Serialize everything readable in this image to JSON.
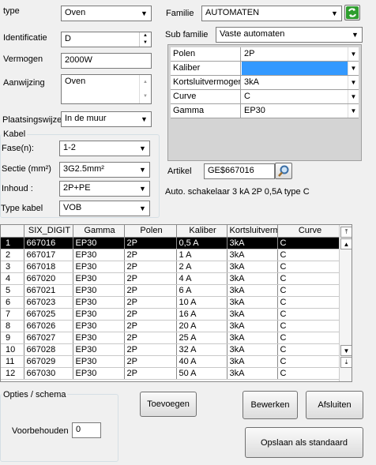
{
  "form": {
    "type_label": "type",
    "type_value": "Oven",
    "identificatie_label": "Identificatie",
    "identificatie_value": "D",
    "vermogen_label": "Vermogen",
    "vermogen_value": "2000W",
    "aanwijzing_label": "Aanwijzing",
    "aanwijzing_value": "Oven",
    "plaatsingswijze_label": "Plaatsingswijze",
    "plaatsingswijze_value": "In de muur"
  },
  "kabel": {
    "legend": "Kabel",
    "fase_label": "Fase(n):",
    "fase_value": "1-2",
    "sectie_label": "Sectie (mm²)",
    "sectie_value": "3G2.5mm²",
    "inhoud_label": "Inhoud :",
    "inhoud_value": "2P+PE",
    "type_kabel_label": "Type kabel",
    "type_kabel_value": "VOB"
  },
  "familie": {
    "label": "Familie",
    "value": "AUTOMATEN",
    "sub_label": "Sub familie",
    "sub_value": "Vaste automaten"
  },
  "properties": [
    {
      "name": "Polen",
      "value": "2P",
      "selected": false
    },
    {
      "name": "Kaliber",
      "value": "",
      "selected": true
    },
    {
      "name": "Kortsluitvermogen",
      "value": "3kA",
      "selected": false
    },
    {
      "name": "Curve",
      "value": "C",
      "selected": false
    },
    {
      "name": "Gamma",
      "value": "EP30",
      "selected": false
    }
  ],
  "artikel": {
    "label": "Artikel",
    "value": "GE$667016",
    "description": "Auto. schakelaar 3 kA 2P 0,5A type C"
  },
  "table": {
    "columns": [
      "SIX_DIGIT",
      "Gamma",
      "Polen",
      "Kaliber",
      "Kortsluitverm",
      "Curve"
    ],
    "rows": [
      [
        "1",
        "667016",
        "EP30",
        "2P",
        "0,5 A",
        "3kA",
        "C"
      ],
      [
        "2",
        "667017",
        "EP30",
        "2P",
        "1 A",
        "3kA",
        "C"
      ],
      [
        "3",
        "667018",
        "EP30",
        "2P",
        "2 A",
        "3kA",
        "C"
      ],
      [
        "4",
        "667020",
        "EP30",
        "2P",
        "4 A",
        "3kA",
        "C"
      ],
      [
        "5",
        "667021",
        "EP30",
        "2P",
        "6 A",
        "3kA",
        "C"
      ],
      [
        "6",
        "667023",
        "EP30",
        "2P",
        "10 A",
        "3kA",
        "C"
      ],
      [
        "7",
        "667025",
        "EP30",
        "2P",
        "16 A",
        "3kA",
        "C"
      ],
      [
        "8",
        "667026",
        "EP30",
        "2P",
        "20 A",
        "3kA",
        "C"
      ],
      [
        "9",
        "667027",
        "EP30",
        "2P",
        "25 A",
        "3kA",
        "C"
      ],
      [
        "10",
        "667028",
        "EP30",
        "2P",
        "32 A",
        "3kA",
        "C"
      ],
      [
        "11",
        "667029",
        "EP30",
        "2P",
        "40 A",
        "3kA",
        "C"
      ],
      [
        "12",
        "667030",
        "EP30",
        "2P",
        "50 A",
        "3kA",
        "C"
      ]
    ],
    "selected_row": 0
  },
  "opties": {
    "legend": "Opties / schema",
    "voorbehouden_label": "Voorbehouden",
    "voorbehouden_value": "0"
  },
  "buttons": {
    "toevoegen": "Toevoegen",
    "bewerken": "Bewerken",
    "afsluiten": "Afsluiten",
    "opslaan": "Opslaan als standaard"
  },
  "colors": {
    "selection": "#3399ff",
    "refresh_icon": "#2e9e2e"
  }
}
